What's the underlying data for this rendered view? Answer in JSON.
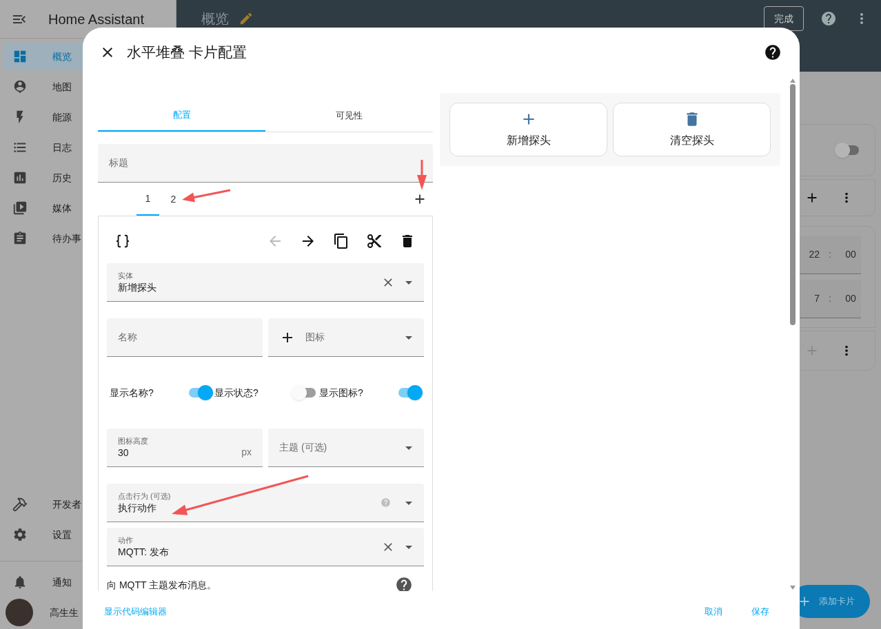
{
  "sidebar": {
    "title": "Home Assistant",
    "items": [
      {
        "label": "概览",
        "selected": true
      },
      {
        "label": "地图",
        "selected": false
      },
      {
        "label": "能源",
        "selected": false
      },
      {
        "label": "日志",
        "selected": false
      },
      {
        "label": "历史",
        "selected": false
      },
      {
        "label": "媒体",
        "selected": false
      },
      {
        "label": "待办事",
        "selected": false
      }
    ],
    "bottom_items": [
      {
        "label": "开发者",
        "selected": false
      },
      {
        "label": "设置",
        "selected": false
      }
    ],
    "notifications": "通知",
    "user": "高生生"
  },
  "top_bar": {
    "title": "概览",
    "done_button": "完成"
  },
  "background_cards": {
    "toggle": {
      "on": false
    },
    "time_rows": [
      {
        "hour": "22",
        "separator": ":",
        "minute": "00"
      },
      {
        "hour": "7",
        "separator": ":",
        "minute": "00"
      }
    ]
  },
  "add_card_button": "添加卡片",
  "dialog": {
    "title": "水平堆叠 卡片配置",
    "tabs": [
      {
        "label": "配置",
        "selected": true
      },
      {
        "label": "可见性",
        "selected": false
      }
    ],
    "title_field": {
      "placeholder": "标题"
    },
    "card_tabs": [
      {
        "label": "1",
        "selected": true
      },
      {
        "label": "2",
        "selected": false
      }
    ],
    "toolbar": {
      "previous_disabled": true
    },
    "entity_field": {
      "label": "实体",
      "value": "新增探头"
    },
    "name_field": {
      "placeholder": "名称"
    },
    "icon_field": {
      "placeholder": "图标"
    },
    "toggles": [
      {
        "label": "显示名称?",
        "on": true
      },
      {
        "label": "显示状态?",
        "on": false
      },
      {
        "label": "显示图标?",
        "on": true
      }
    ],
    "icon_height_field": {
      "label": "图标高度",
      "value": "30",
      "suffix": "px"
    },
    "theme_field": {
      "placeholder": "主题 (可选)"
    },
    "tap_action_field": {
      "label": "点击行为 (可选)",
      "value": "执行动作"
    },
    "action_field": {
      "label": "动作",
      "value": "MQTT: 发布"
    },
    "description": "向 MQTT 主题发布消息。",
    "preview_buttons": [
      {
        "label": "新增探头"
      },
      {
        "label": "清空探头"
      }
    ],
    "footer": {
      "code_editor_link": "显示代码编辑器",
      "cancel": "取消",
      "save": "保存"
    }
  }
}
